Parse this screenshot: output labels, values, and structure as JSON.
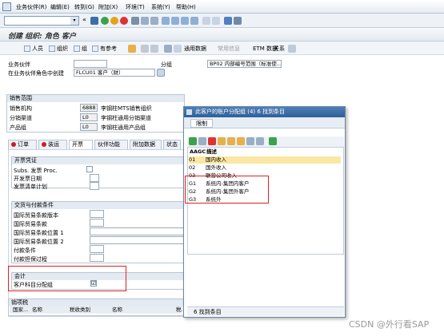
{
  "menu": [
    "业务伙伴(R)",
    "编辑(E)",
    "转到(G)",
    "附加(X)",
    "环境(T)",
    "系统(Y)",
    "帮助(H)"
  ],
  "title": "创建 组织: 角色 客户",
  "toolbar2": [
    "人员",
    "组织",
    "组",
    "有参考",
    "通用数据",
    "常用信息",
    "ETM 数据",
    "关系"
  ],
  "form": {
    "bp_label": "业务伙伴",
    "group_label": "分组",
    "group_value": "BP02 内部编号范围（标准使...",
    "role_label": "在业务伙伴角色中创建",
    "role_value": "FLCU01 客户（财）"
  },
  "sales_area": {
    "title": "销售范围",
    "org_label": "销售机构",
    "org_value": "6888",
    "org_desc": "李钢柱MTS销售组织",
    "channel_label": "分销渠道",
    "channel_value": "L0",
    "channel_desc": "李钢柱通用分销渠道",
    "division_label": "产品组",
    "division_value": "L0",
    "division_desc": "李钢柱通用产品组"
  },
  "tabs": [
    "订单",
    "装运",
    "开票",
    "伙伴功能",
    "附加数据",
    "状态"
  ],
  "billing": {
    "title": "开票凭证",
    "fields": [
      "Subs. 发票 Proc.",
      "开发票日期",
      "发票清单计划"
    ]
  },
  "delivery": {
    "title": "交货与付款条件",
    "fields": [
      "国际贸易条款版本",
      "国际贸易条款",
      "国际贸易条款位置 1",
      "国际贸易条款位置 2",
      "付款条件",
      "付款担保过程"
    ]
  },
  "accounting": {
    "title": "会计",
    "field": "客户科目分配组",
    "checked": "☑"
  },
  "tax": {
    "title": "销项税",
    "cols": [
      "国家...",
      "名称",
      "税收类别",
      "名称",
      "税..."
    ]
  },
  "popup": {
    "title": "此客户的账户分配组 (4)   6 找到条目",
    "tab": "限制",
    "col_code": "AAGC",
    "col_desc": "描述",
    "rows": [
      {
        "code": "01",
        "desc": "国内收入"
      },
      {
        "code": "02",
        "desc": "国外收入"
      },
      {
        "code": "03",
        "desc": "联营公司收入"
      },
      {
        "code": "G1",
        "desc": "系统内-集团内客户"
      },
      {
        "code": "G2",
        "desc": "系统内-集团外客户"
      },
      {
        "code": "G3",
        "desc": "系统外"
      }
    ],
    "footer": "6 找到条目"
  },
  "watermark": "CSDN @外行看SAP"
}
